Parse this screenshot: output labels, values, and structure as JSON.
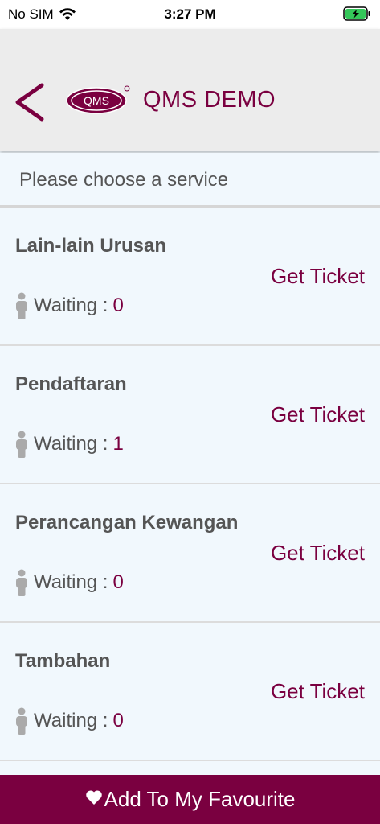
{
  "status_bar": {
    "carrier": "No SIM",
    "time": "3:27 PM",
    "battery_color": "#34c759"
  },
  "header": {
    "logo_text": "QMS",
    "title": "QMS DEMO",
    "brand_color": "#7a0040"
  },
  "subheader": {
    "text": "Please choose a service"
  },
  "services": [
    {
      "name": "Lain-lain Urusan",
      "ticket_label": "Get Ticket",
      "waiting_label": "Waiting :",
      "waiting_count": "0"
    },
    {
      "name": "Pendaftaran",
      "ticket_label": "Get Ticket",
      "waiting_label": "Waiting :",
      "waiting_count": "1"
    },
    {
      "name": "Perancangan Kewangan",
      "ticket_label": "Get Ticket",
      "waiting_label": "Waiting :",
      "waiting_count": "0"
    },
    {
      "name": "Tambahan",
      "ticket_label": "Get Ticket",
      "waiting_label": "Waiting :",
      "waiting_count": "0"
    }
  ],
  "footer": {
    "favourite_label": "Add To My Favourite",
    "icon": "heart-icon"
  }
}
